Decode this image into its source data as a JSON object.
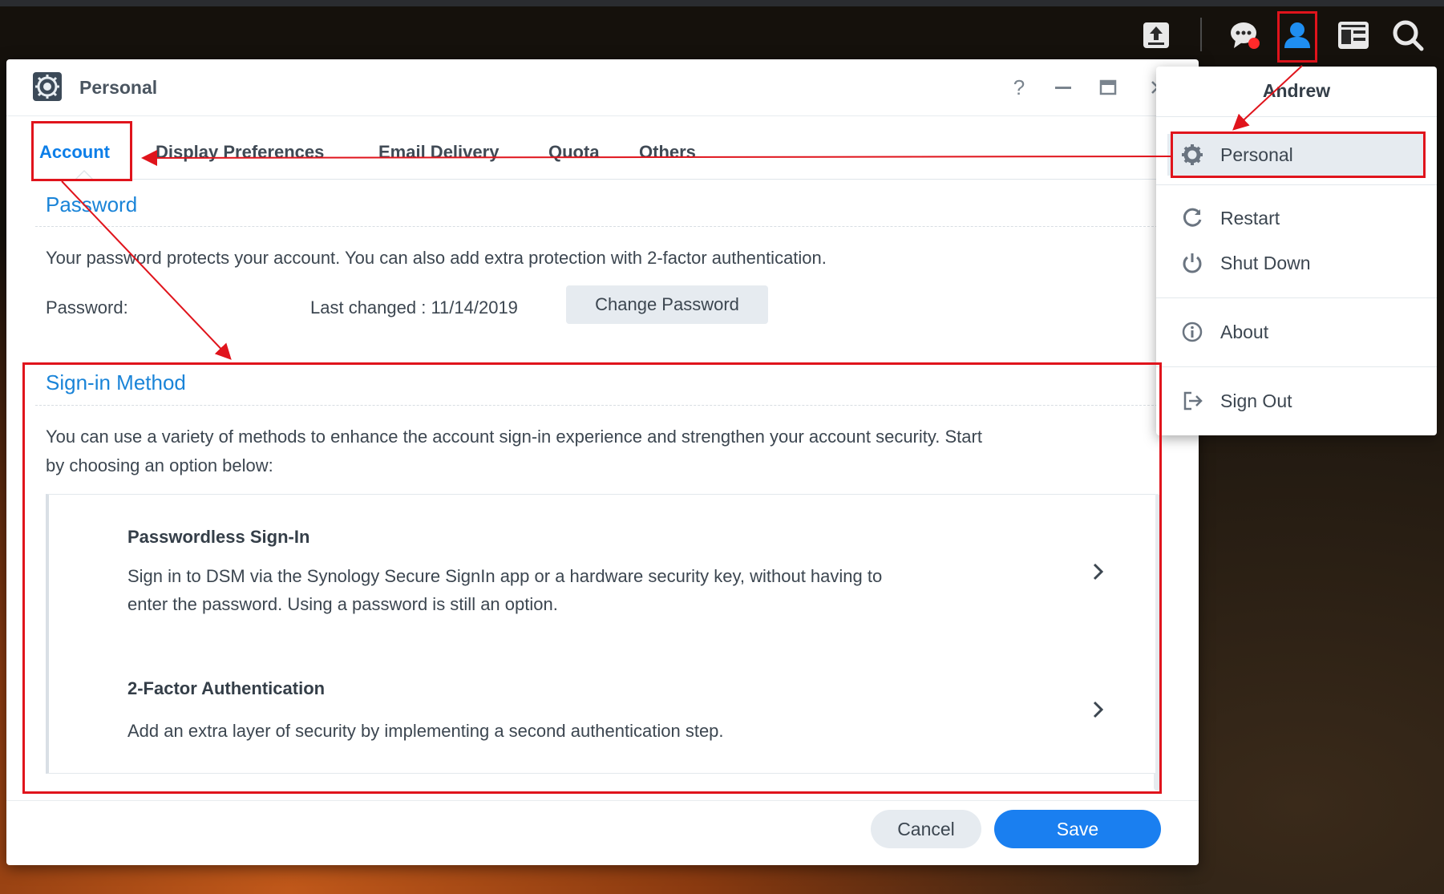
{
  "window": {
    "title": "Personal",
    "help_icon": "question-icon",
    "minimize_icon": "minimize-icon",
    "maximize_icon": "maximize-icon",
    "close_icon": "close-icon"
  },
  "tabs": [
    {
      "label": "Account",
      "active": true
    },
    {
      "label": "Display Preferences",
      "active": false
    },
    {
      "label": "Email Delivery",
      "active": false
    },
    {
      "label": "Quota",
      "active": false
    },
    {
      "label": "Others",
      "active": false
    }
  ],
  "password_section": {
    "title": "Password",
    "description": "Your password protects your account. You can also add extra protection with 2-factor authentication.",
    "field_label": "Password:",
    "last_changed": "Last changed : 11/14/2019",
    "change_button": "Change Password"
  },
  "signin_section": {
    "title": "Sign-in Method",
    "description_line1": "You can use a variety of methods to enhance the account sign-in experience and strengthen your account security. Start",
    "description_line2": "by choosing an option below:",
    "options": [
      {
        "title": "Passwordless Sign-In",
        "desc_line1": "Sign in to DSM via the Synology Secure SignIn app or a hardware security key, without having to",
        "desc_line2": "enter the password. Using a password is still an option."
      },
      {
        "title": "2-Factor Authentication",
        "desc_line1": "Add an extra layer of security by implementing a second authentication step."
      }
    ]
  },
  "footer": {
    "cancel": "Cancel",
    "save": "Save"
  },
  "user_menu": {
    "username": "Andrew",
    "items": [
      {
        "label": "Personal",
        "icon": "gear-icon"
      },
      {
        "label": "Restart",
        "icon": "restart-icon"
      },
      {
        "label": "Shut Down",
        "icon": "power-icon"
      },
      {
        "label": "About",
        "icon": "info-icon"
      },
      {
        "label": "Sign Out",
        "icon": "sign-out-icon"
      }
    ]
  },
  "taskbar": {
    "icons": [
      "upload-icon",
      "chat-icon",
      "user-icon",
      "widgets-icon",
      "search-icon"
    ]
  },
  "colors": {
    "accent": "#1a7ff0",
    "annotation": "#e0141c",
    "notification_dot": "#ff2a2a"
  }
}
